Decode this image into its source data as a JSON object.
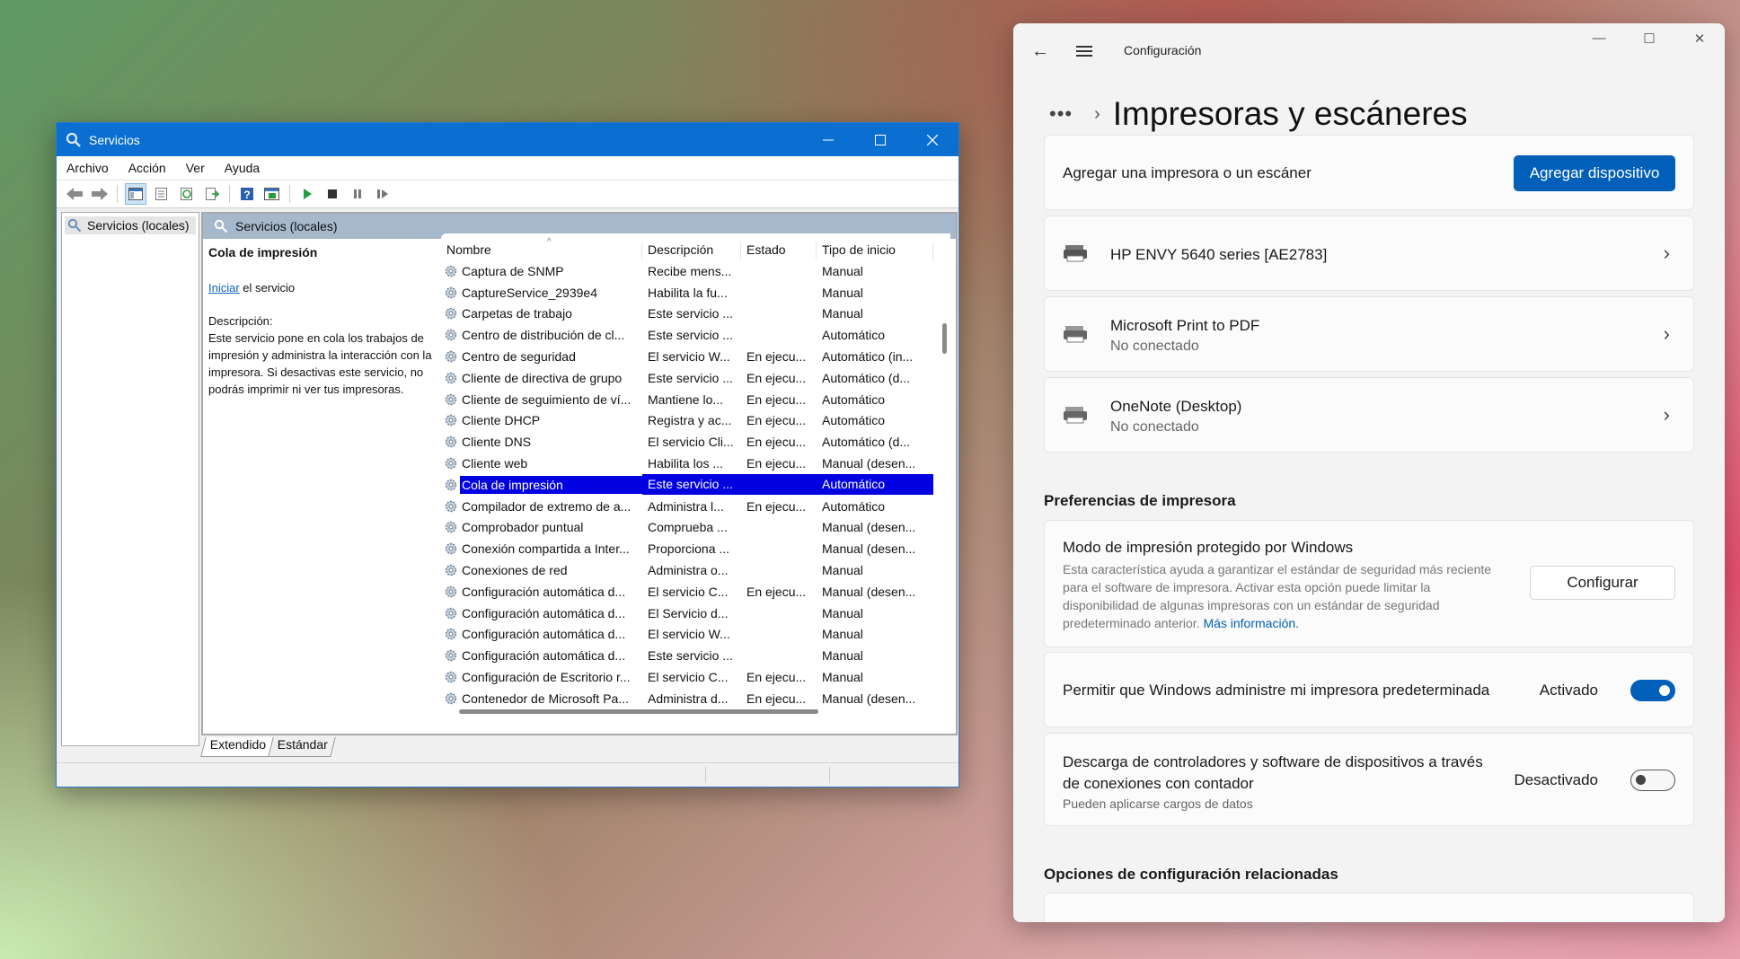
{
  "services": {
    "title": "Servicios",
    "menu": [
      "Archivo",
      "Acción",
      "Ver",
      "Ayuda"
    ],
    "tree_item": "Servicios (locales)",
    "pane_header": "Servicios (locales)",
    "detail": {
      "title": "Cola de impresión",
      "start_link": "Iniciar",
      "start_rest": " el servicio",
      "desc_label": "Descripción:",
      "desc_text": "Este servicio pone en cola los trabajos de impresión y administra la interacción con la impresora.  Si desactivas este servicio, no podrás imprimir ni ver tus impresoras."
    },
    "columns": [
      "Nombre",
      "Descripción",
      "Estado",
      "Tipo de inicio"
    ],
    "rows": [
      {
        "name": "Captura de SNMP",
        "desc": "Recibe mens...",
        "state": "",
        "start": "Manual"
      },
      {
        "name": "CaptureService_2939e4",
        "desc": "Habilita la fu...",
        "state": "",
        "start": "Manual"
      },
      {
        "name": "Carpetas de trabajo",
        "desc": "Este servicio ...",
        "state": "",
        "start": "Manual"
      },
      {
        "name": "Centro de distribución de cl...",
        "desc": "Este servicio ...",
        "state": "",
        "start": "Automático"
      },
      {
        "name": "Centro de seguridad",
        "desc": "El servicio W...",
        "state": "En ejecu...",
        "start": "Automático (in..."
      },
      {
        "name": "Cliente de directiva de grupo",
        "desc": "Este servicio ...",
        "state": "En ejecu...",
        "start": "Automático (d..."
      },
      {
        "name": "Cliente de seguimiento de ví...",
        "desc": "Mantiene lo...",
        "state": "En ejecu...",
        "start": "Automático"
      },
      {
        "name": "Cliente DHCP",
        "desc": "Registra y ac...",
        "state": "En ejecu...",
        "start": "Automático"
      },
      {
        "name": "Cliente DNS",
        "desc": "El servicio Cli...",
        "state": "En ejecu...",
        "start": "Automático (d..."
      },
      {
        "name": "Cliente web",
        "desc": "Habilita los ...",
        "state": "En ejecu...",
        "start": "Manual (desen..."
      },
      {
        "name": "Cola de impresión",
        "desc": "Este servicio ...",
        "state": "",
        "start": "Automático",
        "selected": true
      },
      {
        "name": "Compilador de extremo de a...",
        "desc": "Administra l...",
        "state": "En ejecu...",
        "start": "Automático"
      },
      {
        "name": "Comprobador puntual",
        "desc": "Comprueba ...",
        "state": "",
        "start": "Manual (desen..."
      },
      {
        "name": "Conexión compartida a Inter...",
        "desc": "Proporciona ...",
        "state": "",
        "start": "Manual (desen..."
      },
      {
        "name": "Conexiones de red",
        "desc": "Administra o...",
        "state": "",
        "start": "Manual"
      },
      {
        "name": "Configuración automática d...",
        "desc": "El servicio C...",
        "state": "En ejecu...",
        "start": "Manual (desen..."
      },
      {
        "name": "Configuración automática d...",
        "desc": "El Servicio d...",
        "state": "",
        "start": "Manual"
      },
      {
        "name": "Configuración automática d...",
        "desc": "El servicio W...",
        "state": "",
        "start": "Manual"
      },
      {
        "name": "Configuración automática d...",
        "desc": "Este servicio ...",
        "state": "",
        "start": "Manual"
      },
      {
        "name": "Configuración de Escritorio r...",
        "desc": "El servicio C...",
        "state": "En ejecu...",
        "start": "Manual"
      },
      {
        "name": "Contenedor de Microsoft Pa...",
        "desc": "Administra d...",
        "state": "En ejecu...",
        "start": "Manual (desen..."
      }
    ],
    "tabs": [
      "Extendido",
      "Estándar"
    ]
  },
  "settings": {
    "app_title": "Configuración",
    "breadcrumb_dots": "•••",
    "page_title": "Impresoras y escáneres",
    "add_card": {
      "label": "Agregar una impresora o un escáner",
      "button": "Agregar dispositivo"
    },
    "printers": [
      {
        "name": "HP ENVY 5640 series [AE2783]",
        "status": ""
      },
      {
        "name": "Microsoft Print to PDF",
        "status": "No conectado"
      },
      {
        "name": "OneNote (Desktop)",
        "status": "No conectado"
      }
    ],
    "prefs_header": "Preferencias de impresora",
    "protected": {
      "title": "Modo de impresión protegido por Windows",
      "desc": "Esta característica ayuda a garantizar el estándar de seguridad más reciente para el software de impresora. Activar esta opción puede limitar la disponibilidad de algunas impresoras con un estándar de seguridad predeterminado anterior.",
      "more": "Más información.",
      "button": "Configurar"
    },
    "default_printer": {
      "label": "Permitir que Windows administre mi impresora predeterminada",
      "state": "Activado",
      "on": true
    },
    "metered": {
      "label_line1": "Descarga de controladores y software de dispositivos a través",
      "label_line2": "de conexiones con contador",
      "sub": "Pueden aplicarse cargos de datos",
      "state": "Desactivado",
      "on": false
    },
    "related_header": "Opciones de configuración relacionadas"
  }
}
